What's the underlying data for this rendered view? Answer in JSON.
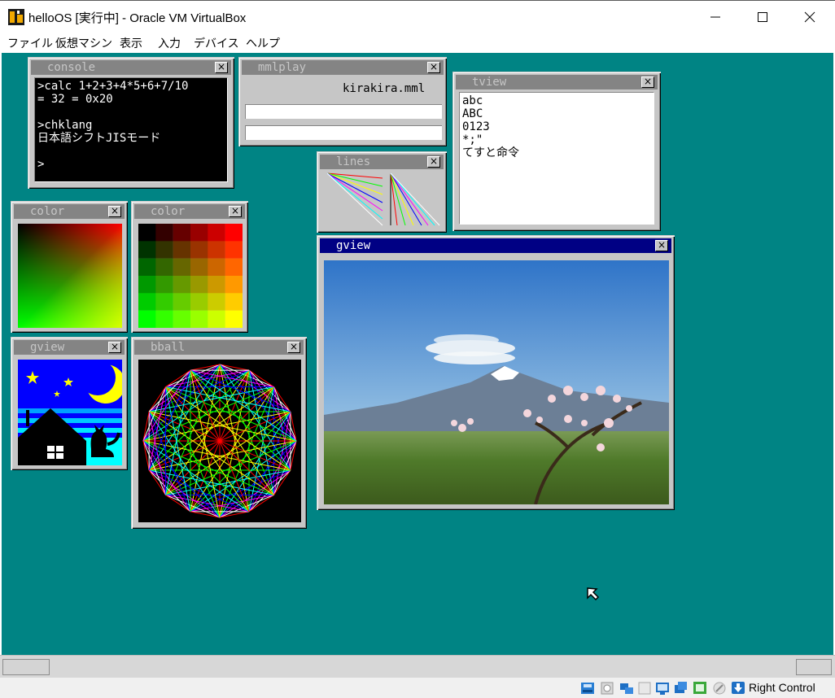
{
  "window": {
    "title": "helloOS [実行中] - Oracle VM VirtualBox",
    "minimize_icon": "minimize-icon",
    "maximize_icon": "maximize-icon",
    "close_icon": "close-icon"
  },
  "menu": {
    "items": [
      "ファイル",
      "仮想マシン",
      "表示",
      "入力",
      "デバイス",
      "ヘルプ"
    ]
  },
  "guest": {
    "desktop_color": "#008484",
    "windows": {
      "console": {
        "title": "console",
        "lines": [
          ">calc 1+2+3+4*5+6+7/10",
          "= 32 = 0x20",
          "",
          ">chklang",
          "日本語シフトJISモード",
          "",
          ">"
        ]
      },
      "mmlplay": {
        "title": "mmlplay",
        "filename": "kirakira.mml"
      },
      "tview": {
        "title": "tview",
        "lines": [
          "abc",
          "ABC",
          "0123",
          "*;\"",
          "てすと命令"
        ]
      },
      "lines": {
        "title": "lines"
      },
      "color1": {
        "title": "color"
      },
      "color2": {
        "title": "color"
      },
      "gview_small": {
        "title": "gview"
      },
      "bball": {
        "title": "bball"
      },
      "gview_photo": {
        "title": "gview"
      }
    },
    "close_glyph": "×"
  },
  "statusbar": {
    "host_key_label": "Right Control",
    "icons": [
      "hard-disk-icon",
      "optical-drive-icon",
      "audio-icon",
      "network-icon",
      "usb-icon",
      "shared-folder-icon",
      "display-icon",
      "recording-icon",
      "cpu-icon",
      "mouse-integration-icon",
      "host-key-icon"
    ]
  }
}
